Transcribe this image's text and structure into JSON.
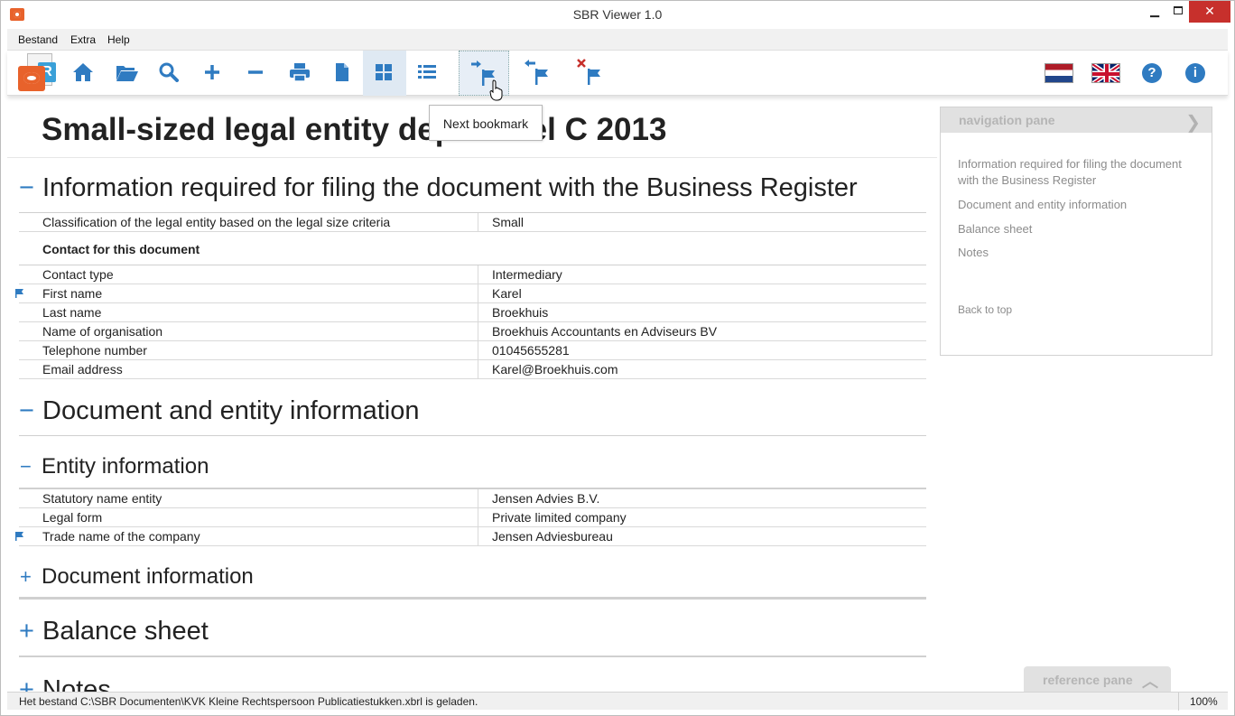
{
  "window": {
    "title": "SBR Viewer 1.0",
    "minimize": "▁",
    "close": "✕"
  },
  "menu": [
    "Bestand",
    "Extra",
    "Help"
  ],
  "toolbar": {
    "tooltip": "Next bookmark",
    "buttons": [
      "home-icon",
      "folder-open-icon",
      "search-icon",
      "zoom-in-icon",
      "zoom-out-icon",
      "print-icon",
      "document-icon",
      "grid-view-icon",
      "list-view-icon",
      "next-bookmark-icon",
      "previous-bookmark-icon",
      "remove-bookmark-icon"
    ],
    "help_label": "?",
    "info_label": "i"
  },
  "document": {
    "title": "Small-sized legal entity dep        model C 2013",
    "sections": {
      "filing": {
        "toggle": "−",
        "title": "Information required for filing the document with the Business Register",
        "rows": [
          {
            "label": "Classification of the legal entity based on the legal size criteria",
            "value": "Small"
          }
        ],
        "contact_heading": "Contact for this document",
        "contact_rows": [
          {
            "label": "Contact type",
            "value": "Intermediary"
          },
          {
            "label": "First name",
            "value": "Karel"
          },
          {
            "label": "Last name",
            "value": "Broekhuis"
          },
          {
            "label": "Name of organisation",
            "value": "Broekhuis Accountants en Adviseurs BV"
          },
          {
            "label": "Telephone number",
            "value": "01045655281"
          },
          {
            "label": "Email address",
            "value": "Karel@Broekhuis.com"
          }
        ]
      },
      "doc_entity": {
        "toggle": "−",
        "title": "Document and entity information",
        "entity": {
          "toggle": "−",
          "title": "Entity information",
          "rows": [
            {
              "label": "Statutory name entity",
              "value": "Jensen Advies B.V."
            },
            {
              "label": "Legal form",
              "value": "Private limited company"
            },
            {
              "label": "Trade name of the company",
              "value": "Jensen Adviesbureau"
            }
          ]
        },
        "document_info": {
          "toggle": "+",
          "title": "Document information"
        }
      },
      "balance": {
        "toggle": "+",
        "title": "Balance sheet"
      },
      "notes": {
        "toggle": "+",
        "title": "Notes"
      }
    }
  },
  "navigation_pane": {
    "header": "navigation pane",
    "chevron": "❯",
    "links": [
      "Information required for filing the document with the Business Register",
      "Document and entity information",
      "Balance sheet",
      "Notes"
    ],
    "back_to_top": "Back to top"
  },
  "reference_pane": {
    "label": "reference pane",
    "chevron": "︿"
  },
  "status": {
    "message": "Het bestand C:\\SBR Documenten\\KVK Kleine Rechtspersoon Publicatiestukken.xbrl is geladen.",
    "zoom": "100%"
  },
  "colors": {
    "accent": "#2f7bc1",
    "close": "#c7302c",
    "logo": "#e8622b"
  }
}
